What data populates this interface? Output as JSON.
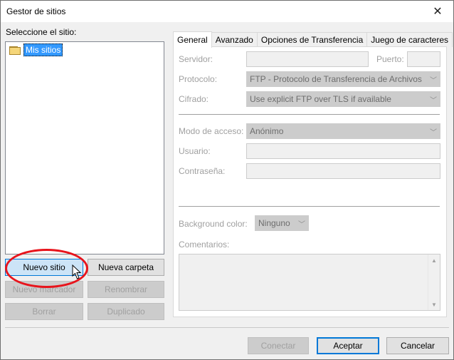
{
  "window": {
    "title": "Gestor de sitios",
    "close_glyph": "✕"
  },
  "left": {
    "select_label": "Seleccione el sitio:",
    "tree": [
      {
        "label": "Mis sitios",
        "icon": "folder-icon",
        "selected": true
      }
    ],
    "buttons": {
      "new_site": "Nuevo sitio",
      "new_folder": "Nueva carpeta",
      "new_bookmark": "Nuevo marcador",
      "rename": "Renombrar",
      "delete": "Borrar",
      "duplicate": "Duplicado"
    }
  },
  "tabs": [
    "General",
    "Avanzado",
    "Opciones de Transferencia",
    "Juego de caracteres"
  ],
  "general": {
    "server_label": "Servidor:",
    "port_label": "Puerto:",
    "protocol_label": "Protocolo:",
    "protocol_value": "FTP - Protocolo de Transferencia de Archivos",
    "encryption_label": "Cifrado:",
    "encryption_value": "Use explicit FTP over TLS if available",
    "access_mode_label": "Modo de acceso:",
    "access_mode_value": "Anónimo",
    "user_label": "Usuario:",
    "password_label": "Contraseña:",
    "bg_color_label": "Background color:",
    "bg_color_value": "Ninguno",
    "comments_label": "Comentarios:"
  },
  "footer": {
    "connect": "Conectar",
    "accept": "Aceptar",
    "cancel": "Cancelar"
  },
  "colors": {
    "highlight_ellipse": "#e8141c",
    "selection": "#3399ff",
    "accent": "#0078d7"
  }
}
